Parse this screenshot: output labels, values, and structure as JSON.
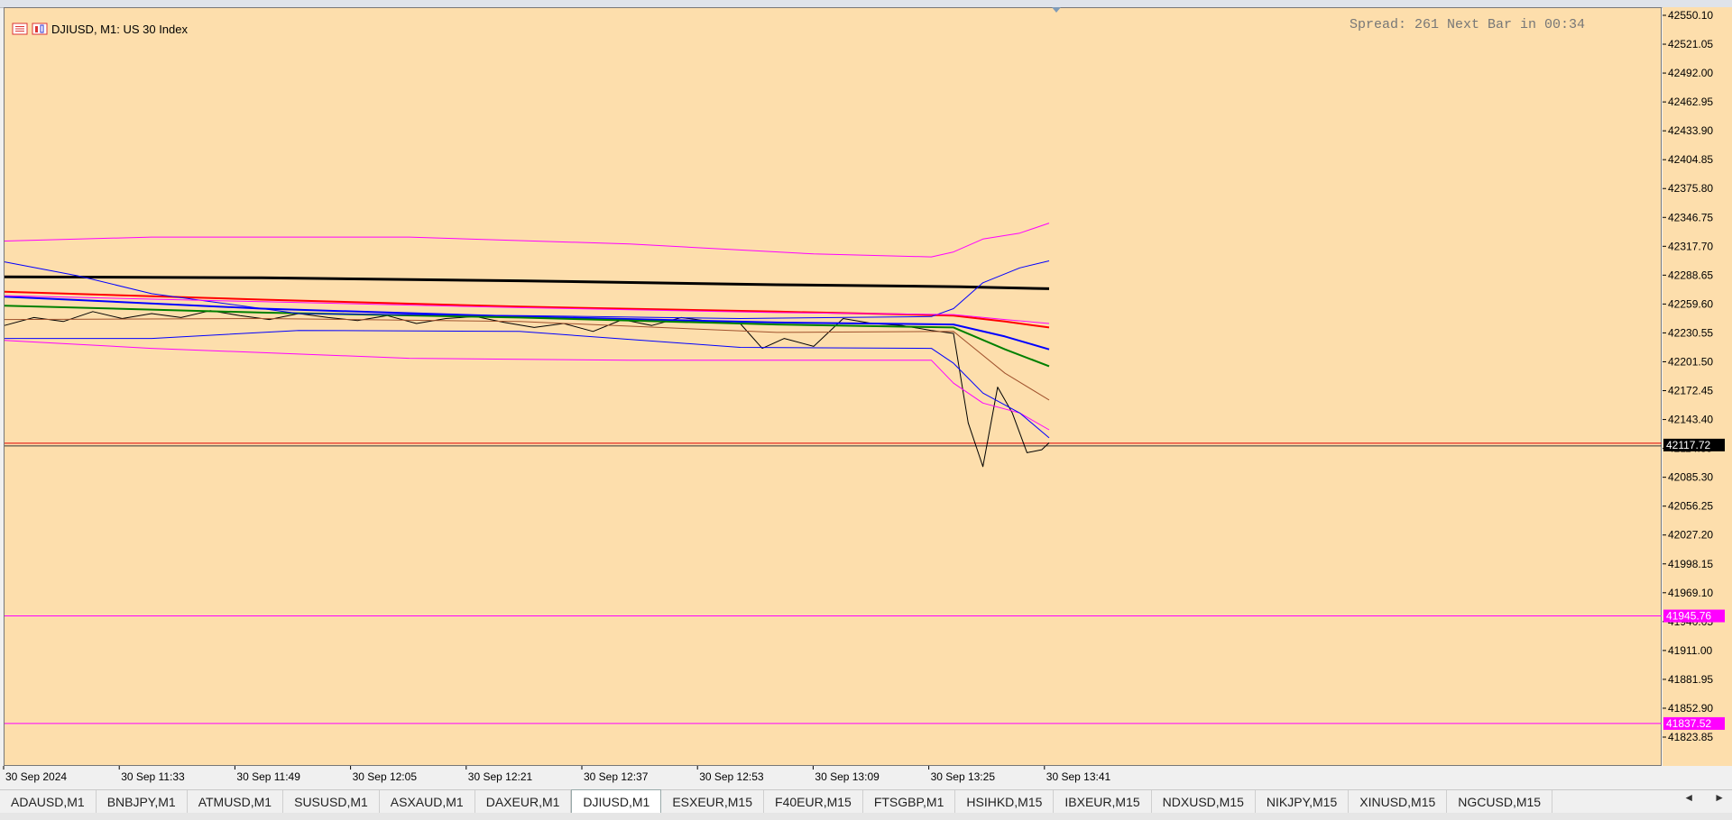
{
  "window": {
    "title": "DJIUSD, M1:  US 30 Index",
    "spread_text": "Spread: 261 Next Bar in 00:34"
  },
  "icons": [
    "chart-list-icon",
    "chart-type-icon"
  ],
  "chart_data": {
    "type": "line",
    "symbol": "DJIUSD",
    "timeframe": "M1",
    "y_ticks": [
      42550.1,
      42521.05,
      42492.0,
      42462.95,
      42433.9,
      42404.85,
      42375.8,
      42346.75,
      42317.7,
      42288.65,
      42259.6,
      42230.55,
      42201.5,
      42172.45,
      42143.4,
      42114.35,
      42085.3,
      42056.25,
      42027.2,
      41998.15,
      41969.1,
      41940.05,
      41911.0,
      41881.95,
      41852.9,
      41823.85
    ],
    "y_tick_labels": [
      "42550.10",
      "42521.05",
      "42492.00",
      "42462.95",
      "42433.90",
      "42404.85",
      "42375.80",
      "42346.75",
      "42317.70",
      "42288.65",
      "42259.60",
      "42230.55",
      "42201.50",
      "42172.45",
      "42143.40",
      "42114.35",
      "42085.30",
      "42056.25",
      "42027.20",
      "41998.15",
      "41969.10",
      "41940.05",
      "41911.00",
      "41881.95",
      "41852.90",
      "41823.85"
    ],
    "ylim": [
      41805,
      42560
    ],
    "x_labels": [
      "30 Sep 2024",
      "30 Sep 11:33",
      "30 Sep 11:49",
      "30 Sep 12:05",
      "30 Sep 12:21",
      "30 Sep 12:37",
      "30 Sep 12:53",
      "30 Sep 13:09",
      "30 Sep 13:25",
      "30 Sep 13:41"
    ],
    "xlim": [
      0,
      145
    ],
    "current_price": {
      "value": 42117.72,
      "label": "42117.72"
    },
    "levels": [
      {
        "value": 41945.76,
        "label": "41945.76",
        "color": "#ff00ff"
      },
      {
        "value": 41837.52,
        "label": "41837.52",
        "color": "#ff00ff"
      }
    ],
    "series": [
      {
        "kind": "price",
        "color": "#000000",
        "width": 1,
        "x": [
          0,
          4,
          8,
          12,
          16,
          20,
          24,
          28,
          32,
          36,
          40,
          44,
          48,
          52,
          56,
          60,
          64,
          68,
          72,
          76,
          80,
          84,
          88,
          92,
          96,
          100,
          103,
          106,
          110,
          114,
          118,
          122,
          126,
          129,
          131,
          133,
          135,
          137,
          139,
          141,
          142
        ],
        "y": [
          42238,
          42246,
          42242,
          42252,
          42245,
          42250,
          42246,
          42253,
          42248,
          42244,
          42250,
          42246,
          42243,
          42248,
          42240,
          42245,
          42247,
          42241,
          42236,
          42240,
          42232,
          42244,
          42238,
          42246,
          42242,
          42240,
          42215,
          42225,
          42217,
          42245,
          42240,
          42238,
          42233,
          42230,
          42140,
          42096,
          42176,
          42150,
          42110,
          42113,
          42120
        ]
      },
      {
        "kind": "ma",
        "color": "#000000",
        "width": 3,
        "x": [
          0,
          35,
          70,
          105,
          130,
          142
        ],
        "y": [
          42287,
          42286,
          42283,
          42279,
          42277,
          42275
        ]
      },
      {
        "kind": "ma",
        "color": "#ff0000",
        "width": 2,
        "x": [
          0,
          35,
          70,
          105,
          129,
          136,
          142
        ],
        "y": [
          42272,
          42264,
          42257,
          42252,
          42248,
          42242,
          42236
        ]
      },
      {
        "kind": "ma",
        "color": "#0000ff",
        "width": 2,
        "x": [
          0,
          35,
          70,
          105,
          129,
          136,
          142
        ],
        "y": [
          42267,
          42255,
          42247,
          42241,
          42239,
          42227,
          42214
        ]
      },
      {
        "kind": "ma",
        "color": "#008000",
        "width": 2,
        "x": [
          0,
          35,
          70,
          105,
          129,
          136,
          142
        ],
        "y": [
          42258,
          42251,
          42246,
          42239,
          42236,
          42214,
          42197
        ]
      },
      {
        "kind": "ma",
        "color": "#a0522d",
        "width": 1,
        "x": [
          0,
          35,
          70,
          105,
          129,
          136,
          142
        ],
        "y": [
          42244,
          42245,
          42242,
          42231,
          42232,
          42190,
          42163
        ]
      },
      {
        "kind": "band",
        "color": "#ff00ff",
        "width": 1,
        "x": [
          0,
          20,
          55,
          85,
          110,
          126,
          129,
          133,
          138,
          142
        ],
        "y": [
          42323,
          42327,
          42327,
          42320,
          42310,
          42307,
          42312,
          42325,
          42331,
          42341
        ]
      },
      {
        "kind": "band",
        "color": "#ff00ff",
        "width": 1,
        "x": [
          0,
          20,
          55,
          85,
          110,
          126,
          129,
          133,
          138,
          142
        ],
        "y": [
          42223,
          42215,
          42205,
          42203,
          42203,
          42203,
          42180,
          42160,
          42150,
          42133
        ]
      },
      {
        "kind": "band",
        "color": "#0000ff",
        "width": 1,
        "x": [
          0,
          10,
          20,
          40,
          70,
          100,
          126,
          129,
          133,
          138,
          142
        ],
        "y": [
          42302,
          42288,
          42270,
          42250,
          42248,
          42245,
          42247,
          42255,
          42281,
          42296,
          42303
        ]
      },
      {
        "kind": "band",
        "color": "#0000ff",
        "width": 1,
        "x": [
          0,
          20,
          40,
          70,
          100,
          126,
          129,
          133,
          138,
          142
        ],
        "y": [
          42225,
          42225,
          42233,
          42232,
          42216,
          42215,
          42200,
          42170,
          42150,
          42125
        ]
      },
      {
        "kind": "band",
        "color": "#ff00ff",
        "width": 1,
        "x": [
          0,
          35,
          70,
          105,
          129,
          136,
          142
        ],
        "y": [
          42268,
          42262,
          42256,
          42251,
          42249,
          42244,
          42240
        ]
      }
    ]
  },
  "tabs": {
    "active_index": 6,
    "items": [
      "ADAUSD,M1",
      "BNBJPY,M1",
      "ATMUSD,M1",
      "SUSUSD,M1",
      "ASXAUD,M1",
      "DAXEUR,M1",
      "DJIUSD,M1",
      "ESXEUR,M15",
      "F40EUR,M15",
      "FTSGBP,M1",
      "HSIHKD,M15",
      "IBXEUR,M15",
      "NDXUSD,M15",
      "NIKJPY,M15",
      "XINUSD,M15",
      "NGCUSD,M15"
    ],
    "nav_left": "◄",
    "nav_right": "►"
  }
}
